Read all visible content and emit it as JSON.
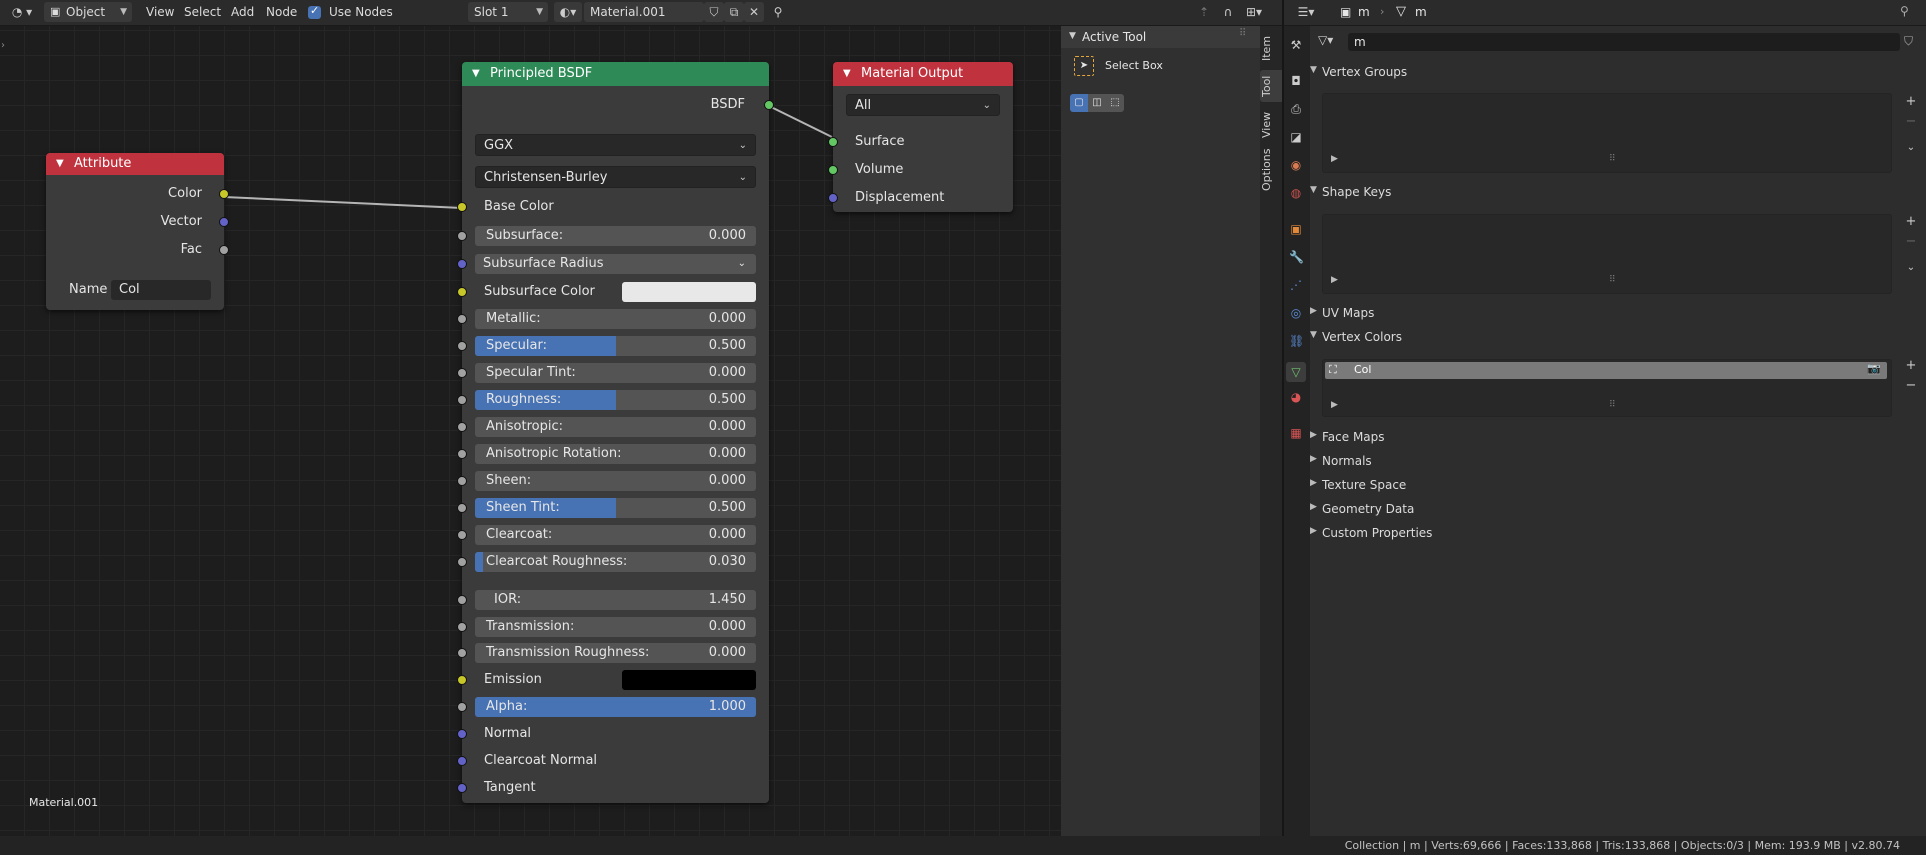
{
  "node_editor": {
    "header": {
      "editor_type_icon": "node-editor-icon",
      "mode": "Object",
      "menus": [
        "View",
        "Select",
        "Add",
        "Node"
      ],
      "use_nodes_label": "Use Nodes",
      "use_nodes_checked": true,
      "slot": "Slot 1",
      "material_name": "Material.001"
    },
    "material_label": "Material.001",
    "attribute_node": {
      "title": "Attribute",
      "outputs": [
        "Color",
        "Vector",
        "Fac"
      ],
      "name_label": "Name",
      "name_value": "Col"
    },
    "bsdf_node": {
      "title": "Principled BSDF",
      "output": "BSDF",
      "distribution": "GGX",
      "subsurface_method": "Christensen-Burley",
      "base_color_label": "Base Color",
      "subsurface": {
        "label": "Subsurface:",
        "value": "0.000"
      },
      "subsurface_radius": "Subsurface Radius",
      "subsurface_color_label": "Subsurface Color",
      "subsurface_color": "#e8e8e8",
      "sliders": [
        {
          "label": "Metallic:",
          "value": "0.000",
          "fill": 0
        },
        {
          "label": "Specular:",
          "value": "0.500",
          "fill": 0.5
        },
        {
          "label": "Specular Tint:",
          "value": "0.000",
          "fill": 0
        },
        {
          "label": "Roughness:",
          "value": "0.500",
          "fill": 0.5
        },
        {
          "label": "Anisotropic:",
          "value": "0.000",
          "fill": 0
        },
        {
          "label": "Anisotropic Rotation:",
          "value": "0.000",
          "fill": 0
        },
        {
          "label": "Sheen:",
          "value": "0.000",
          "fill": 0
        },
        {
          "label": "Sheen Tint:",
          "value": "0.500",
          "fill": 0.5
        },
        {
          "label": "Clearcoat:",
          "value": "0.000",
          "fill": 0
        },
        {
          "label": "Clearcoat Roughness:",
          "value": "0.030",
          "fill": 0.03
        }
      ],
      "ior": {
        "label": "IOR:",
        "value": "1.450"
      },
      "transmission": {
        "label": "Transmission:",
        "value": "0.000"
      },
      "transmission_roughness": {
        "label": "Transmission Roughness:",
        "value": "0.000"
      },
      "emission_label": "Emission",
      "emission_color": "#000000",
      "alpha": {
        "label": "Alpha:",
        "value": "1.000",
        "fill": 1
      },
      "vector_inputs": [
        "Normal",
        "Clearcoat Normal",
        "Tangent"
      ]
    },
    "output_node": {
      "title": "Material Output",
      "target": "All",
      "inputs": [
        "Surface",
        "Volume",
        "Displacement"
      ]
    }
  },
  "tool_panel": {
    "header": "Active Tool",
    "tool_name": "Select Box",
    "tabs": [
      "Item",
      "Tool",
      "View",
      "Options"
    ]
  },
  "properties": {
    "header_object": "m",
    "header_data": "m",
    "data_name": "m",
    "panels": {
      "vertex_groups": "Vertex Groups",
      "shape_keys": "Shape Keys",
      "uv_maps": "UV Maps",
      "vertex_colors": "Vertex Colors",
      "face_maps": "Face Maps",
      "normals": "Normals",
      "texture_space": "Texture Space",
      "geometry_data": "Geometry Data",
      "custom_properties": "Custom Properties"
    },
    "vertex_color_item": "Col"
  },
  "status_bar": {
    "text": "Collection | m | Verts:69,666 | Faces:133,868 | Tris:133,868 | Objects:0/3 | Mem: 193.9 MB | v2.80.74"
  },
  "colors": {
    "attribute_header": "#c0333e",
    "bsdf_header": "#2e8a57",
    "output_header": "#c0333e",
    "slider_fill": "#4772b3"
  }
}
